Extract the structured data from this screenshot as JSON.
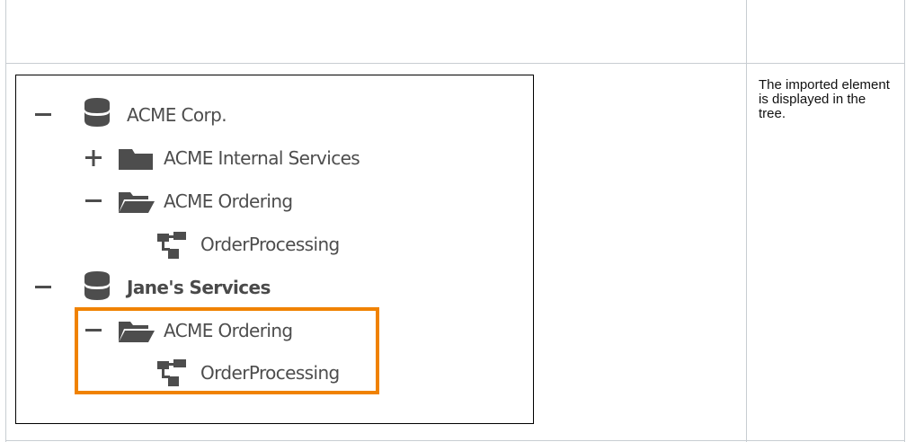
{
  "tree": {
    "nodes": [
      {
        "label": "ACME Corp.",
        "toggle": "minus",
        "icon": "database-icon"
      },
      {
        "label": "ACME Internal Services",
        "toggle": "plus",
        "icon": "folder-closed-icon"
      },
      {
        "label": "ACME Ordering",
        "toggle": "minus",
        "icon": "folder-open-icon"
      },
      {
        "label": "OrderProcessing",
        "toggle": "",
        "icon": "process-icon"
      },
      {
        "label": "Jane's Services",
        "toggle": "minus",
        "icon": "database-icon"
      },
      {
        "label": "ACME Ordering",
        "toggle": "minus",
        "icon": "folder-open-icon"
      },
      {
        "label": "OrderProcessing",
        "toggle": "",
        "icon": "process-icon"
      }
    ]
  },
  "note": {
    "text": "The imported element is displayed in the tree."
  },
  "colors": {
    "highlight": "#f08200",
    "icon": "#4d4d4d",
    "grid": "#c8cdd2"
  }
}
